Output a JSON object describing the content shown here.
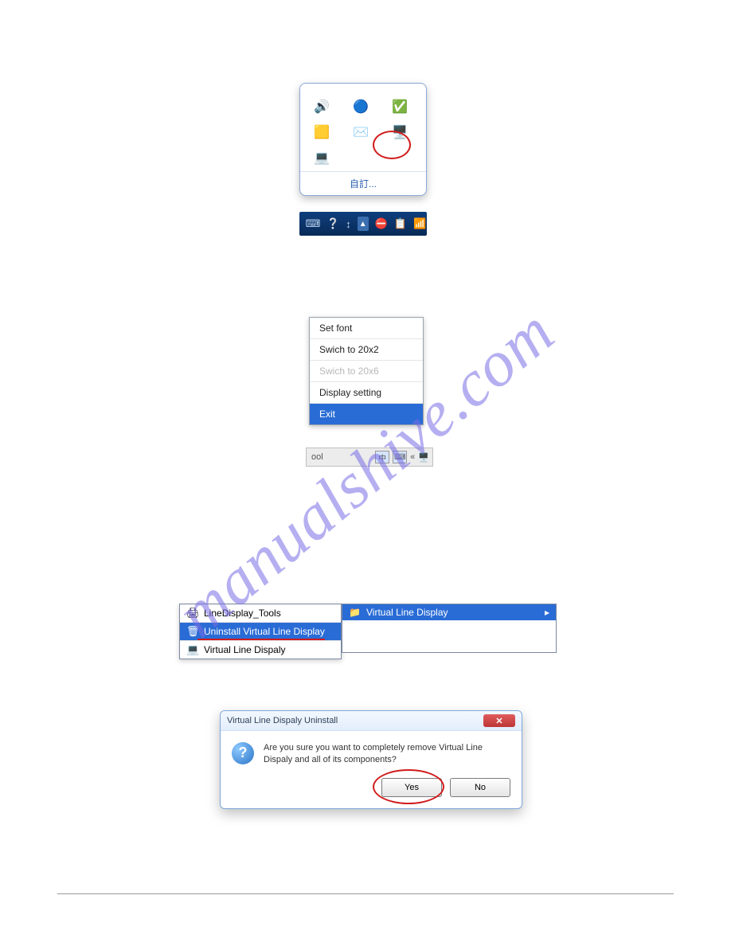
{
  "watermark": "manualshive.com",
  "tray": {
    "icons": [
      "volume-icon",
      "globe-icon",
      "shield-green-icon",
      "outlook-icon",
      "mail-icon",
      "virtual-line-display-icon",
      "monitor-icon"
    ],
    "footer": "自訂..."
  },
  "taskbar": {
    "icons": [
      "keyboard-icon",
      "help-icon",
      "sync-icon",
      "arrow-up-icon",
      "blocked-icon",
      "clipboard-icon",
      "signal-icon"
    ]
  },
  "context_menu": {
    "items": [
      {
        "label": "Set font",
        "state": "normal"
      },
      {
        "label": "Swich to 20x2",
        "state": "normal"
      },
      {
        "label": "Swich to 20x6",
        "state": "disabled"
      },
      {
        "label": "Display setting",
        "state": "normal"
      },
      {
        "label": "Exit",
        "state": "highlight"
      }
    ],
    "bar_text": "ool"
  },
  "start_menu": {
    "left": [
      {
        "label": "LineDisplay_Tools",
        "icon": "printer-icon",
        "selected": false
      },
      {
        "label": "Uninstall Virtual Line Display",
        "icon": "uninstall-icon",
        "selected": true
      },
      {
        "label": "Virtual Line Dispaly",
        "icon": "monitor-icon",
        "selected": false
      }
    ],
    "right": {
      "label": "Virtual Line Display",
      "icon": "folder-icon",
      "arrow": "▸"
    }
  },
  "dialog": {
    "title": "Virtual Line Dispaly Uninstall",
    "message": "Are you sure you want to completely remove Virtual Line Dispaly and all of its components?",
    "yes": "Yes",
    "no": "No",
    "close": "✕"
  },
  "icon_glyphs": {
    "volume-icon": "🔊",
    "globe-icon": "🔵",
    "shield-green-icon": "✅",
    "outlook-icon": "🟨",
    "mail-icon": "✉️",
    "virtual-line-display-icon": "🖥️",
    "monitor-icon": "💻",
    "keyboard-icon": "⌨",
    "help-icon": "❔",
    "sync-icon": "↕",
    "arrow-up-icon": "▲",
    "blocked-icon": "⛔",
    "clipboard-icon": "📋",
    "signal-icon": "📶",
    "printer-icon": "🖨",
    "uninstall-icon": "🗑",
    "folder-icon": "📁"
  }
}
